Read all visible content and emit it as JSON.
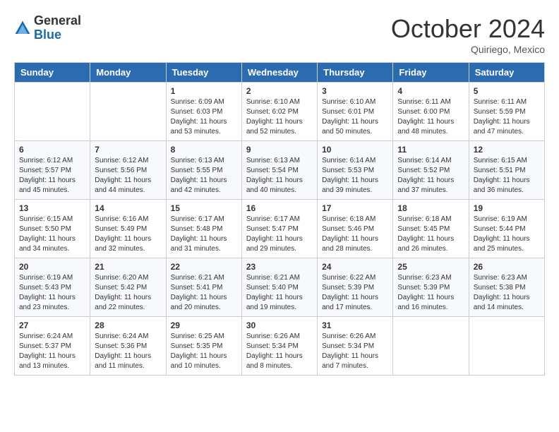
{
  "header": {
    "logo_general": "General",
    "logo_blue": "Blue",
    "month_title": "October 2024",
    "location": "Quiriego, Mexico"
  },
  "days_of_week": [
    "Sunday",
    "Monday",
    "Tuesday",
    "Wednesday",
    "Thursday",
    "Friday",
    "Saturday"
  ],
  "weeks": [
    [
      {
        "day": "",
        "sunrise": "",
        "sunset": "",
        "daylight": ""
      },
      {
        "day": "",
        "sunrise": "",
        "sunset": "",
        "daylight": ""
      },
      {
        "day": "1",
        "sunrise": "Sunrise: 6:09 AM",
        "sunset": "Sunset: 6:03 PM",
        "daylight": "Daylight: 11 hours and 53 minutes."
      },
      {
        "day": "2",
        "sunrise": "Sunrise: 6:10 AM",
        "sunset": "Sunset: 6:02 PM",
        "daylight": "Daylight: 11 hours and 52 minutes."
      },
      {
        "day": "3",
        "sunrise": "Sunrise: 6:10 AM",
        "sunset": "Sunset: 6:01 PM",
        "daylight": "Daylight: 11 hours and 50 minutes."
      },
      {
        "day": "4",
        "sunrise": "Sunrise: 6:11 AM",
        "sunset": "Sunset: 6:00 PM",
        "daylight": "Daylight: 11 hours and 48 minutes."
      },
      {
        "day": "5",
        "sunrise": "Sunrise: 6:11 AM",
        "sunset": "Sunset: 5:59 PM",
        "daylight": "Daylight: 11 hours and 47 minutes."
      }
    ],
    [
      {
        "day": "6",
        "sunrise": "Sunrise: 6:12 AM",
        "sunset": "Sunset: 5:57 PM",
        "daylight": "Daylight: 11 hours and 45 minutes."
      },
      {
        "day": "7",
        "sunrise": "Sunrise: 6:12 AM",
        "sunset": "Sunset: 5:56 PM",
        "daylight": "Daylight: 11 hours and 44 minutes."
      },
      {
        "day": "8",
        "sunrise": "Sunrise: 6:13 AM",
        "sunset": "Sunset: 5:55 PM",
        "daylight": "Daylight: 11 hours and 42 minutes."
      },
      {
        "day": "9",
        "sunrise": "Sunrise: 6:13 AM",
        "sunset": "Sunset: 5:54 PM",
        "daylight": "Daylight: 11 hours and 40 minutes."
      },
      {
        "day": "10",
        "sunrise": "Sunrise: 6:14 AM",
        "sunset": "Sunset: 5:53 PM",
        "daylight": "Daylight: 11 hours and 39 minutes."
      },
      {
        "day": "11",
        "sunrise": "Sunrise: 6:14 AM",
        "sunset": "Sunset: 5:52 PM",
        "daylight": "Daylight: 11 hours and 37 minutes."
      },
      {
        "day": "12",
        "sunrise": "Sunrise: 6:15 AM",
        "sunset": "Sunset: 5:51 PM",
        "daylight": "Daylight: 11 hours and 36 minutes."
      }
    ],
    [
      {
        "day": "13",
        "sunrise": "Sunrise: 6:15 AM",
        "sunset": "Sunset: 5:50 PM",
        "daylight": "Daylight: 11 hours and 34 minutes."
      },
      {
        "day": "14",
        "sunrise": "Sunrise: 6:16 AM",
        "sunset": "Sunset: 5:49 PM",
        "daylight": "Daylight: 11 hours and 32 minutes."
      },
      {
        "day": "15",
        "sunrise": "Sunrise: 6:17 AM",
        "sunset": "Sunset: 5:48 PM",
        "daylight": "Daylight: 11 hours and 31 minutes."
      },
      {
        "day": "16",
        "sunrise": "Sunrise: 6:17 AM",
        "sunset": "Sunset: 5:47 PM",
        "daylight": "Daylight: 11 hours and 29 minutes."
      },
      {
        "day": "17",
        "sunrise": "Sunrise: 6:18 AM",
        "sunset": "Sunset: 5:46 PM",
        "daylight": "Daylight: 11 hours and 28 minutes."
      },
      {
        "day": "18",
        "sunrise": "Sunrise: 6:18 AM",
        "sunset": "Sunset: 5:45 PM",
        "daylight": "Daylight: 11 hours and 26 minutes."
      },
      {
        "day": "19",
        "sunrise": "Sunrise: 6:19 AM",
        "sunset": "Sunset: 5:44 PM",
        "daylight": "Daylight: 11 hours and 25 minutes."
      }
    ],
    [
      {
        "day": "20",
        "sunrise": "Sunrise: 6:19 AM",
        "sunset": "Sunset: 5:43 PM",
        "daylight": "Daylight: 11 hours and 23 minutes."
      },
      {
        "day": "21",
        "sunrise": "Sunrise: 6:20 AM",
        "sunset": "Sunset: 5:42 PM",
        "daylight": "Daylight: 11 hours and 22 minutes."
      },
      {
        "day": "22",
        "sunrise": "Sunrise: 6:21 AM",
        "sunset": "Sunset: 5:41 PM",
        "daylight": "Daylight: 11 hours and 20 minutes."
      },
      {
        "day": "23",
        "sunrise": "Sunrise: 6:21 AM",
        "sunset": "Sunset: 5:40 PM",
        "daylight": "Daylight: 11 hours and 19 minutes."
      },
      {
        "day": "24",
        "sunrise": "Sunrise: 6:22 AM",
        "sunset": "Sunset: 5:39 PM",
        "daylight": "Daylight: 11 hours and 17 minutes."
      },
      {
        "day": "25",
        "sunrise": "Sunrise: 6:23 AM",
        "sunset": "Sunset: 5:39 PM",
        "daylight": "Daylight: 11 hours and 16 minutes."
      },
      {
        "day": "26",
        "sunrise": "Sunrise: 6:23 AM",
        "sunset": "Sunset: 5:38 PM",
        "daylight": "Daylight: 11 hours and 14 minutes."
      }
    ],
    [
      {
        "day": "27",
        "sunrise": "Sunrise: 6:24 AM",
        "sunset": "Sunset: 5:37 PM",
        "daylight": "Daylight: 11 hours and 13 minutes."
      },
      {
        "day": "28",
        "sunrise": "Sunrise: 6:24 AM",
        "sunset": "Sunset: 5:36 PM",
        "daylight": "Daylight: 11 hours and 11 minutes."
      },
      {
        "day": "29",
        "sunrise": "Sunrise: 6:25 AM",
        "sunset": "Sunset: 5:35 PM",
        "daylight": "Daylight: 11 hours and 10 minutes."
      },
      {
        "day": "30",
        "sunrise": "Sunrise: 6:26 AM",
        "sunset": "Sunset: 5:34 PM",
        "daylight": "Daylight: 11 hours and 8 minutes."
      },
      {
        "day": "31",
        "sunrise": "Sunrise: 6:26 AM",
        "sunset": "Sunset: 5:34 PM",
        "daylight": "Daylight: 11 hours and 7 minutes."
      },
      {
        "day": "",
        "sunrise": "",
        "sunset": "",
        "daylight": ""
      },
      {
        "day": "",
        "sunrise": "",
        "sunset": "",
        "daylight": ""
      }
    ]
  ]
}
